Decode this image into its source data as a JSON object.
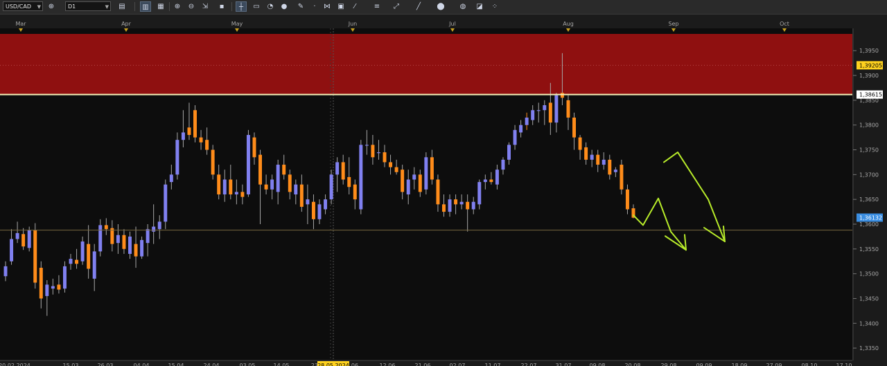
{
  "toolbar": {
    "symbol": "USD/CAD",
    "timeframe": "D1",
    "icons": [
      "chart-type-icon",
      "compare-icon",
      "indicators-icon",
      "crosshair-icon",
      "zoom-in-icon",
      "zoom-out-icon",
      "cursor-icon",
      "trendline-icon",
      "text-icon",
      "shapes-icon",
      "color-icon",
      "pencil-icon",
      "objects-icon",
      "screenshot-icon",
      "fibonacci-icon",
      "channel-icon",
      "gann-icon",
      "circle-icon",
      "delete-icon",
      "settings-icon"
    ]
  },
  "chart_data": {
    "type": "candlestick",
    "symbol": "USD/CAD",
    "timeframe": "D1",
    "ylim": [
      1.3325,
      1.3995
    ],
    "y_ticks": [
      "1,3950",
      "1,3900",
      "1,3850",
      "1,3800",
      "1,3750",
      "1,3700",
      "1,3650",
      "1,3600",
      "1,3550",
      "1,3500",
      "1,3450",
      "1,3400",
      "1,3350"
    ],
    "y_tick_values": [
      1.395,
      1.39,
      1.385,
      1.38,
      1.375,
      1.37,
      1.365,
      1.36,
      1.355,
      1.35,
      1.345,
      1.34,
      1.335
    ],
    "month_labels": [
      "Mar",
      "Apr",
      "May",
      "Jun",
      "Jul",
      "Aug",
      "Sep",
      "Oct"
    ],
    "date_labels": [
      "20.02.2024",
      "15.03",
      "26.03",
      "04.04",
      "15.04",
      "24.04",
      "03.05",
      "14.05",
      "23",
      "28.05.2024",
      "06",
      "12.06",
      "21.06",
      "02.07",
      "11.07",
      "22.07",
      "31.07",
      "09.08",
      "20.08",
      "29.08",
      "09.09",
      "18.09",
      "27.09",
      "08.10",
      "17.10"
    ],
    "highlighted_date": "28.05.2024",
    "price_labels": [
      {
        "text": "1,39205",
        "value": 1.39205,
        "color": "#ffd21f",
        "text_color": "#000000"
      },
      {
        "text": "1,38615",
        "value": 1.38615,
        "color": "#ffffff",
        "text_color": "#000000"
      },
      {
        "text": "1,36132",
        "value": 1.36132,
        "color": "#3a8de0",
        "text_color": "#ffffff"
      }
    ],
    "resistance_zone": {
      "from": 1.38615,
      "to": 1.3995,
      "color": "#8f1010"
    },
    "resistance_line": {
      "value": 1.38615,
      "color": "#f6f2b8"
    },
    "support_line": {
      "value": 1.3588,
      "color": "#7a6a40"
    },
    "dashed_marker_line": "28.05.2024",
    "colors": {
      "up": "#8080f0",
      "down": "#ff8c1a",
      "wick": "#a8a8a8",
      "background": "#0d0d0d",
      "hand_drawn": "#b8ec2a"
    },
    "hand_drawn_forecast": [
      {
        "points": [
          [
            1.3618
          ],
          [
            1.3598
          ],
          [
            1.3652
          ],
          [
            1.3585
          ],
          [
            1.3548
          ]
        ],
        "arrow": "down"
      },
      {
        "points": [
          [
            1.3725
          ],
          [
            1.3745
          ],
          [
            1.365
          ],
          [
            1.3565
          ]
        ],
        "arrow": "down"
      }
    ],
    "candles": [
      {
        "o": 1.3495,
        "h": 1.3525,
        "l": 1.3485,
        "c": 1.3515
      },
      {
        "o": 1.3525,
        "h": 1.359,
        "l": 1.3518,
        "c": 1.357
      },
      {
        "o": 1.357,
        "h": 1.3605,
        "l": 1.3562,
        "c": 1.3582
      },
      {
        "o": 1.358,
        "h": 1.3592,
        "l": 1.3548,
        "c": 1.3555
      },
      {
        "o": 1.3552,
        "h": 1.3595,
        "l": 1.3545,
        "c": 1.3588
      },
      {
        "o": 1.3588,
        "h": 1.3602,
        "l": 1.347,
        "c": 1.3482
      },
      {
        "o": 1.3512,
        "h": 1.3525,
        "l": 1.343,
        "c": 1.345
      },
      {
        "o": 1.3455,
        "h": 1.3487,
        "l": 1.3415,
        "c": 1.3478
      },
      {
        "o": 1.347,
        "h": 1.349,
        "l": 1.3458,
        "c": 1.3475
      },
      {
        "o": 1.3478,
        "h": 1.3497,
        "l": 1.346,
        "c": 1.3468
      },
      {
        "o": 1.347,
        "h": 1.3525,
        "l": 1.3462,
        "c": 1.3515
      },
      {
        "o": 1.352,
        "h": 1.354,
        "l": 1.3508,
        "c": 1.353
      },
      {
        "o": 1.3528,
        "h": 1.355,
        "l": 1.351,
        "c": 1.352
      },
      {
        "o": 1.3525,
        "h": 1.3575,
        "l": 1.3518,
        "c": 1.3565
      },
      {
        "o": 1.356,
        "h": 1.3598,
        "l": 1.349,
        "c": 1.351
      },
      {
        "o": 1.349,
        "h": 1.356,
        "l": 1.3465,
        "c": 1.3545
      },
      {
        "o": 1.3545,
        "h": 1.361,
        "l": 1.3535,
        "c": 1.3598
      },
      {
        "o": 1.3598,
        "h": 1.3612,
        "l": 1.3578,
        "c": 1.359
      },
      {
        "o": 1.3592,
        "h": 1.3608,
        "l": 1.3545,
        "c": 1.356
      },
      {
        "o": 1.3562,
        "h": 1.36,
        "l": 1.354,
        "c": 1.3578
      },
      {
        "o": 1.3578,
        "h": 1.359,
        "l": 1.354,
        "c": 1.355
      },
      {
        "o": 1.354,
        "h": 1.3585,
        "l": 1.353,
        "c": 1.3575
      },
      {
        "o": 1.356,
        "h": 1.3595,
        "l": 1.3512,
        "c": 1.3535
      },
      {
        "o": 1.3535,
        "h": 1.3575,
        "l": 1.353,
        "c": 1.3568
      },
      {
        "o": 1.3562,
        "h": 1.36,
        "l": 1.3535,
        "c": 1.359
      },
      {
        "o": 1.3585,
        "h": 1.364,
        "l": 1.356,
        "c": 1.3595
      },
      {
        "o": 1.359,
        "h": 1.3618,
        "l": 1.357,
        "c": 1.3605
      },
      {
        "o": 1.3605,
        "h": 1.369,
        "l": 1.359,
        "c": 1.368
      },
      {
        "o": 1.3685,
        "h": 1.372,
        "l": 1.367,
        "c": 1.37
      },
      {
        "o": 1.37,
        "h": 1.3785,
        "l": 1.369,
        "c": 1.377
      },
      {
        "o": 1.377,
        "h": 1.383,
        "l": 1.3755,
        "c": 1.3785
      },
      {
        "o": 1.3795,
        "h": 1.3845,
        "l": 1.377,
        "c": 1.378
      },
      {
        "o": 1.383,
        "h": 1.384,
        "l": 1.3765,
        "c": 1.3775
      },
      {
        "o": 1.3775,
        "h": 1.379,
        "l": 1.375,
        "c": 1.3765
      },
      {
        "o": 1.377,
        "h": 1.3795,
        "l": 1.374,
        "c": 1.375
      },
      {
        "o": 1.375,
        "h": 1.376,
        "l": 1.369,
        "c": 1.37
      },
      {
        "o": 1.37,
        "h": 1.372,
        "l": 1.365,
        "c": 1.366
      },
      {
        "o": 1.366,
        "h": 1.371,
        "l": 1.3645,
        "c": 1.369
      },
      {
        "o": 1.369,
        "h": 1.372,
        "l": 1.365,
        "c": 1.366
      },
      {
        "o": 1.366,
        "h": 1.369,
        "l": 1.364,
        "c": 1.3665
      },
      {
        "o": 1.3665,
        "h": 1.368,
        "l": 1.364,
        "c": 1.3655
      },
      {
        "o": 1.366,
        "h": 1.379,
        "l": 1.3655,
        "c": 1.378
      },
      {
        "o": 1.3775,
        "h": 1.3785,
        "l": 1.372,
        "c": 1.3735
      },
      {
        "o": 1.374,
        "h": 1.375,
        "l": 1.36,
        "c": 1.368
      },
      {
        "o": 1.368,
        "h": 1.37,
        "l": 1.366,
        "c": 1.367
      },
      {
        "o": 1.367,
        "h": 1.37,
        "l": 1.365,
        "c": 1.369
      },
      {
        "o": 1.3665,
        "h": 1.373,
        "l": 1.364,
        "c": 1.372
      },
      {
        "o": 1.372,
        "h": 1.374,
        "l": 1.369,
        "c": 1.37
      },
      {
        "o": 1.37,
        "h": 1.371,
        "l": 1.365,
        "c": 1.3665
      },
      {
        "o": 1.366,
        "h": 1.369,
        "l": 1.364,
        "c": 1.368
      },
      {
        "o": 1.368,
        "h": 1.37,
        "l": 1.3625,
        "c": 1.3635
      },
      {
        "o": 1.364,
        "h": 1.368,
        "l": 1.36,
        "c": 1.365
      },
      {
        "o": 1.3645,
        "h": 1.366,
        "l": 1.359,
        "c": 1.361
      },
      {
        "o": 1.361,
        "h": 1.365,
        "l": 1.36,
        "c": 1.364
      },
      {
        "o": 1.363,
        "h": 1.366,
        "l": 1.362,
        "c": 1.365
      },
      {
        "o": 1.365,
        "h": 1.371,
        "l": 1.364,
        "c": 1.37
      },
      {
        "o": 1.37,
        "h": 1.3735,
        "l": 1.3665,
        "c": 1.3725
      },
      {
        "o": 1.3725,
        "h": 1.374,
        "l": 1.368,
        "c": 1.369
      },
      {
        "o": 1.3695,
        "h": 1.3735,
        "l": 1.366,
        "c": 1.3675
      },
      {
        "o": 1.368,
        "h": 1.369,
        "l": 1.363,
        "c": 1.365
      },
      {
        "o": 1.363,
        "h": 1.377,
        "l": 1.362,
        "c": 1.376
      },
      {
        "o": 1.376,
        "h": 1.379,
        "l": 1.374,
        "c": 1.376
      },
      {
        "o": 1.376,
        "h": 1.378,
        "l": 1.372,
        "c": 1.3735
      },
      {
        "o": 1.3745,
        "h": 1.377,
        "l": 1.373,
        "c": 1.3745
      },
      {
        "o": 1.3745,
        "h": 1.376,
        "l": 1.3715,
        "c": 1.3725
      },
      {
        "o": 1.3725,
        "h": 1.374,
        "l": 1.37,
        "c": 1.3715
      },
      {
        "o": 1.3715,
        "h": 1.373,
        "l": 1.37,
        "c": 1.3705
      },
      {
        "o": 1.371,
        "h": 1.372,
        "l": 1.365,
        "c": 1.3665
      },
      {
        "o": 1.366,
        "h": 1.371,
        "l": 1.364,
        "c": 1.369
      },
      {
        "o": 1.369,
        "h": 1.3715,
        "l": 1.367,
        "c": 1.37
      },
      {
        "o": 1.37,
        "h": 1.371,
        "l": 1.3655,
        "c": 1.3665
      },
      {
        "o": 1.367,
        "h": 1.3745,
        "l": 1.366,
        "c": 1.3735
      },
      {
        "o": 1.3735,
        "h": 1.375,
        "l": 1.368,
        "c": 1.369
      },
      {
        "o": 1.369,
        "h": 1.37,
        "l": 1.3625,
        "c": 1.364
      },
      {
        "o": 1.364,
        "h": 1.366,
        "l": 1.3615,
        "c": 1.3625
      },
      {
        "o": 1.3625,
        "h": 1.366,
        "l": 1.3615,
        "c": 1.365
      },
      {
        "o": 1.365,
        "h": 1.366,
        "l": 1.362,
        "c": 1.364
      },
      {
        "o": 1.364,
        "h": 1.366,
        "l": 1.363,
        "c": 1.3645
      },
      {
        "o": 1.3645,
        "h": 1.366,
        "l": 1.3585,
        "c": 1.363
      },
      {
        "o": 1.363,
        "h": 1.3655,
        "l": 1.362,
        "c": 1.3645
      },
      {
        "o": 1.364,
        "h": 1.369,
        "l": 1.363,
        "c": 1.3685
      },
      {
        "o": 1.3685,
        "h": 1.37,
        "l": 1.367,
        "c": 1.369
      },
      {
        "o": 1.369,
        "h": 1.3705,
        "l": 1.368,
        "c": 1.3685
      },
      {
        "o": 1.368,
        "h": 1.372,
        "l": 1.367,
        "c": 1.371
      },
      {
        "o": 1.371,
        "h": 1.3735,
        "l": 1.37,
        "c": 1.373
      },
      {
        "o": 1.373,
        "h": 1.3765,
        "l": 1.372,
        "c": 1.376
      },
      {
        "o": 1.376,
        "h": 1.38,
        "l": 1.375,
        "c": 1.379
      },
      {
        "o": 1.3785,
        "h": 1.381,
        "l": 1.3775,
        "c": 1.38
      },
      {
        "o": 1.38,
        "h": 1.3825,
        "l": 1.379,
        "c": 1.3815
      },
      {
        "o": 1.381,
        "h": 1.384,
        "l": 1.38,
        "c": 1.383
      },
      {
        "o": 1.383,
        "h": 1.3845,
        "l": 1.3805,
        "c": 1.383
      },
      {
        "o": 1.383,
        "h": 1.385,
        "l": 1.38,
        "c": 1.384
      },
      {
        "o": 1.3845,
        "h": 1.3885,
        "l": 1.378,
        "c": 1.3805
      },
      {
        "o": 1.3805,
        "h": 1.3865,
        "l": 1.3785,
        "c": 1.386
      },
      {
        "o": 1.3865,
        "h": 1.3945,
        "l": 1.384,
        "c": 1.3855
      },
      {
        "o": 1.385,
        "h": 1.386,
        "l": 1.379,
        "c": 1.3815
      },
      {
        "o": 1.3815,
        "h": 1.3825,
        "l": 1.375,
        "c": 1.3775
      },
      {
        "o": 1.3775,
        "h": 1.378,
        "l": 1.373,
        "c": 1.375
      },
      {
        "o": 1.3755,
        "h": 1.3765,
        "l": 1.372,
        "c": 1.373
      },
      {
        "o": 1.373,
        "h": 1.375,
        "l": 1.3715,
        "c": 1.374
      },
      {
        "o": 1.374,
        "h": 1.375,
        "l": 1.3705,
        "c": 1.372
      },
      {
        "o": 1.372,
        "h": 1.3745,
        "l": 1.371,
        "c": 1.373
      },
      {
        "o": 1.373,
        "h": 1.374,
        "l": 1.369,
        "c": 1.37
      },
      {
        "o": 1.3705,
        "h": 1.3715,
        "l": 1.3695,
        "c": 1.371
      },
      {
        "o": 1.372,
        "h": 1.373,
        "l": 1.366,
        "c": 1.367
      },
      {
        "o": 1.367,
        "h": 1.368,
        "l": 1.362,
        "c": 1.363
      },
      {
        "o": 1.3632,
        "h": 1.364,
        "l": 1.3612,
        "c": 1.3613
      }
    ]
  }
}
